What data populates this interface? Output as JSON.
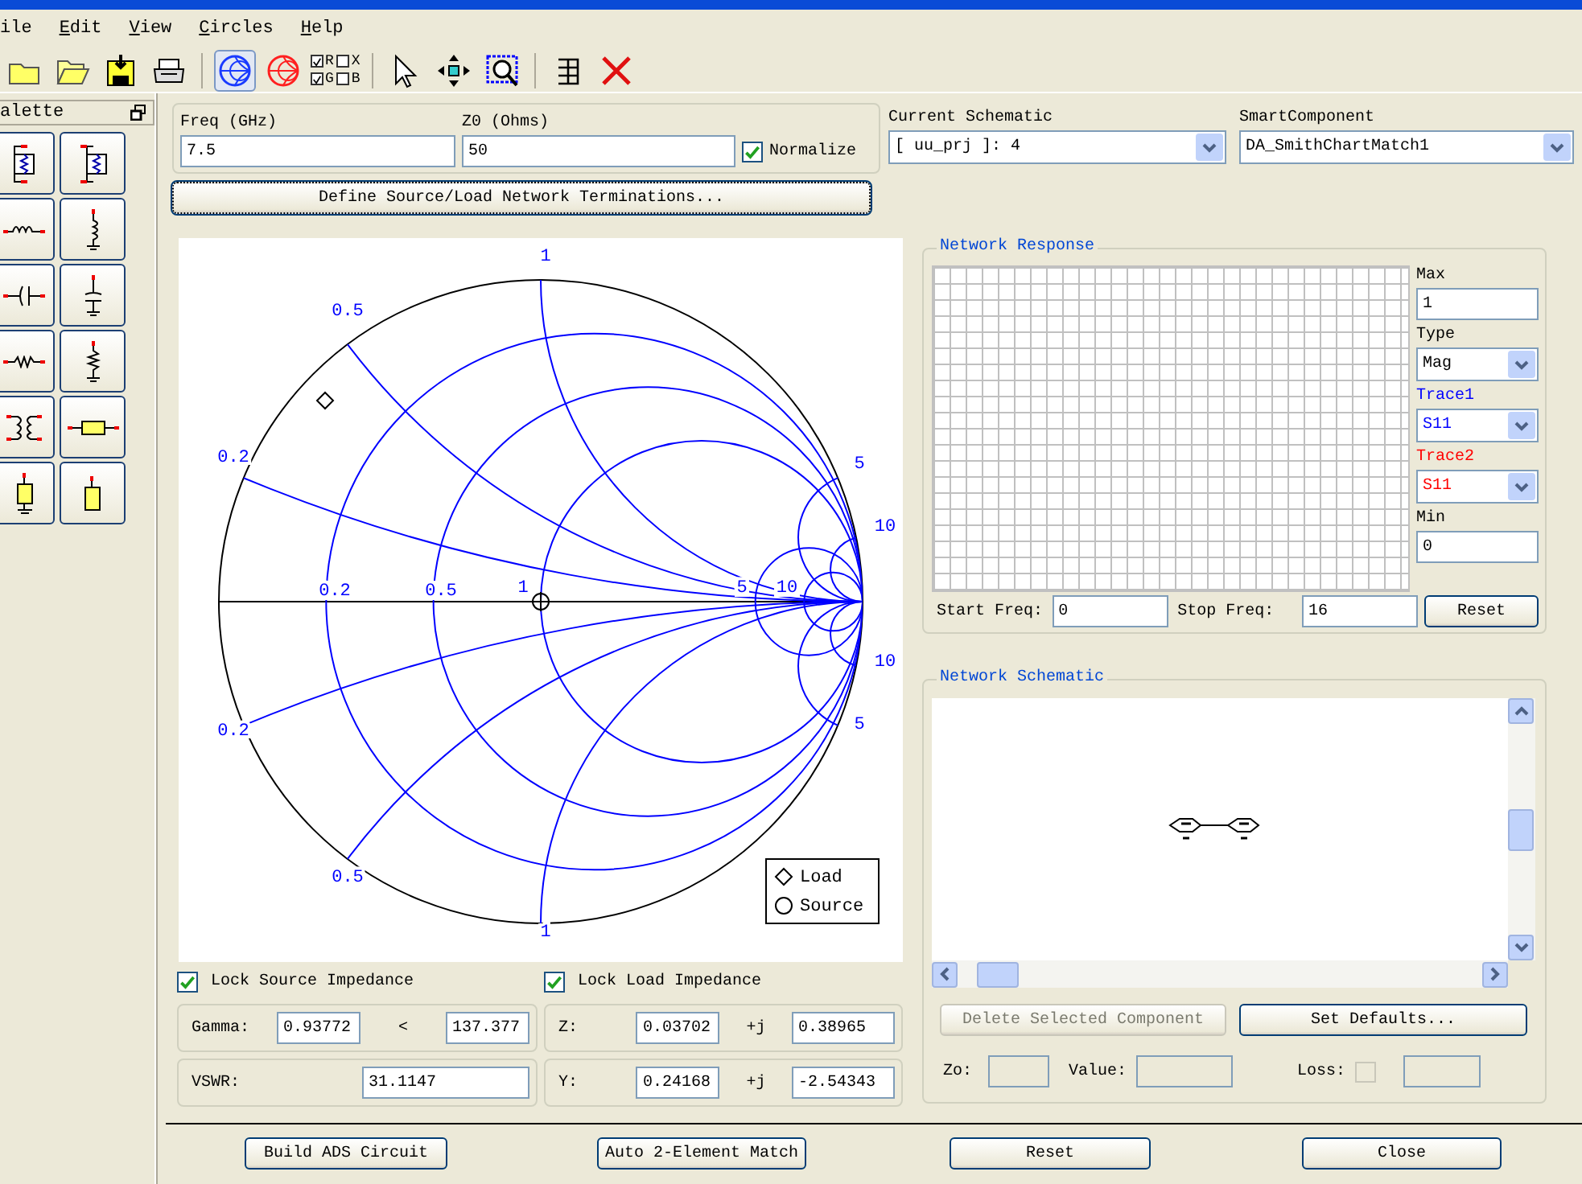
{
  "menu": [
    {
      "label": "ile",
      "mnemonic": false
    },
    {
      "label": "Edit",
      "mnemonic": true
    },
    {
      "label": "View",
      "mnemonic": true
    },
    {
      "label": "Circles",
      "mnemonic": true
    },
    {
      "label": "Help",
      "mnemonic": true
    }
  ],
  "toolbar": {
    "chart_modes": [
      {
        "kind": "impedance",
        "selected": true
      },
      {
        "kind": "admittance",
        "selected": false
      }
    ],
    "toggles": [
      {
        "label": "R",
        "checked": true
      },
      {
        "label": "X",
        "checked": false
      },
      {
        "label": "G",
        "checked": true
      },
      {
        "label": "B",
        "checked": false
      }
    ]
  },
  "palette": {
    "title": "alette"
  },
  "freq": {
    "label": "Freq (GHz)",
    "value": "7.5"
  },
  "z0": {
    "label": "Z0 (Ohms)",
    "value": "50"
  },
  "normalize": {
    "label": "Normalize",
    "checked": true
  },
  "define_button": "Define Source/Load Network Terminations...",
  "current_schematic": {
    "label": "Current Schematic",
    "value": "[ uu_prj ]: 4"
  },
  "smart_component": {
    "label": "SmartComponent",
    "value": "DA_SmithChartMatch1"
  },
  "smith_chart": {
    "labels": [
      "1",
      "0.5",
      "0.2",
      "0.2",
      "0.5",
      "1",
      "5",
      "10",
      "5",
      "10",
      "10",
      "5",
      "0.2",
      "0.5",
      "1"
    ],
    "legend": [
      {
        "kind": "load",
        "label": "Load"
      },
      {
        "kind": "source",
        "label": "Source"
      }
    ]
  },
  "lock_source": {
    "label": "Lock Source Impedance",
    "checked": true
  },
  "lock_load": {
    "label": "Lock Load Impedance",
    "checked": true
  },
  "gamma": {
    "label": "Gamma:",
    "magnitude": "0.93772",
    "angle_sign": "<",
    "angle": "137.377"
  },
  "vswr": {
    "label": "VSWR:",
    "value": "31.1147"
  },
  "z": {
    "label": "Z:",
    "real": "0.03702",
    "j": "+j",
    "imag": "0.38965"
  },
  "y": {
    "label": "Y:",
    "real": "0.24168",
    "j": "+j",
    "imag": "-2.54343"
  },
  "network_response": {
    "title": "Network Response",
    "max": {
      "label": "Max",
      "value": "1"
    },
    "type": {
      "label": "Type",
      "value": "Mag"
    },
    "traces": [
      {
        "label": "Trace1",
        "value": "S11",
        "color": "#0000ff"
      },
      {
        "label": "Trace2",
        "value": "S11",
        "color": "#ff0000"
      }
    ],
    "min": {
      "label": "Min",
      "value": "0"
    },
    "start_freq": {
      "label": "Start Freq:",
      "value": "0"
    },
    "stop_freq": {
      "label": "Stop Freq:",
      "value": "16"
    },
    "reset": "Reset"
  },
  "network_schematic": {
    "title": "Network Schematic",
    "delete_button": {
      "label": "Delete Selected Component",
      "disabled": true
    },
    "set_defaults": "Set Defaults...",
    "zo": {
      "label": "Zo:"
    },
    "value": {
      "label": "Value:"
    },
    "loss": {
      "label": "Loss:",
      "checked": false
    }
  },
  "buttons": [
    "Build ADS Circuit",
    "Auto 2-Element Match",
    "Reset",
    "Close"
  ]
}
